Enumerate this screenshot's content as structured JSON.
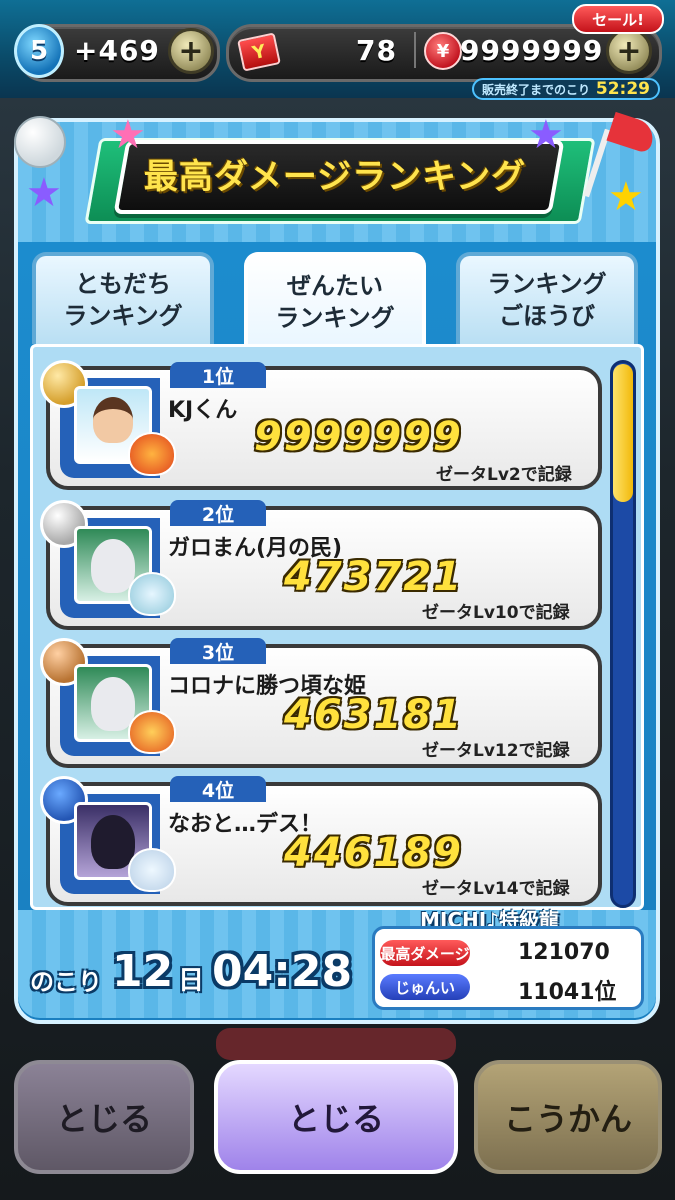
{
  "topbar": {
    "level": "5",
    "stamina": "+469",
    "plus": "+",
    "ticket_icon_text": "Y",
    "tickets": "78",
    "coins": "9999999",
    "sale_label": "セール!",
    "sale_timer_label": "販売終了までのこり",
    "sale_timer": "52:29"
  },
  "banner": {
    "title": "最高ダメージランキング"
  },
  "tabs": [
    {
      "line1": "ともだち",
      "line2": "ランキング"
    },
    {
      "line1": "ぜんたい",
      "line2": "ランキング"
    },
    {
      "line1": "ランキング",
      "line2": "ごほうび"
    }
  ],
  "rankings": [
    {
      "rank": "1位",
      "name": "KJくん",
      "score": "9999999",
      "record": "ゼータLv2で記録"
    },
    {
      "rank": "2位",
      "name": "ガロまん(月の民)",
      "score": "473721",
      "record": "ゼータLv10で記録"
    },
    {
      "rank": "3位",
      "name": "コロナに勝つ頃な姫",
      "score": "463181",
      "record": "ゼータLv12で記録"
    },
    {
      "rank": "4位",
      "name": "なおと…デス！",
      "score": "446189",
      "record": "ゼータLv14で記録"
    }
  ],
  "remaining": {
    "label": "のこり",
    "days": "12",
    "day_unit": "日",
    "time": "04:28"
  },
  "my_stats": {
    "name": "MICHI♪特級龍",
    "damage_label": "最高ダメージ",
    "damage_value": "121070",
    "rank_label": "じゅんい",
    "rank_value": "11041位"
  },
  "buttons": {
    "left": "とじる",
    "center": "とじる",
    "right": "こうかん"
  },
  "colors": {
    "panel_blue": "#1c8ed0",
    "score_yellow": "#ffe13d",
    "banner_green": "#1fbf7a"
  }
}
